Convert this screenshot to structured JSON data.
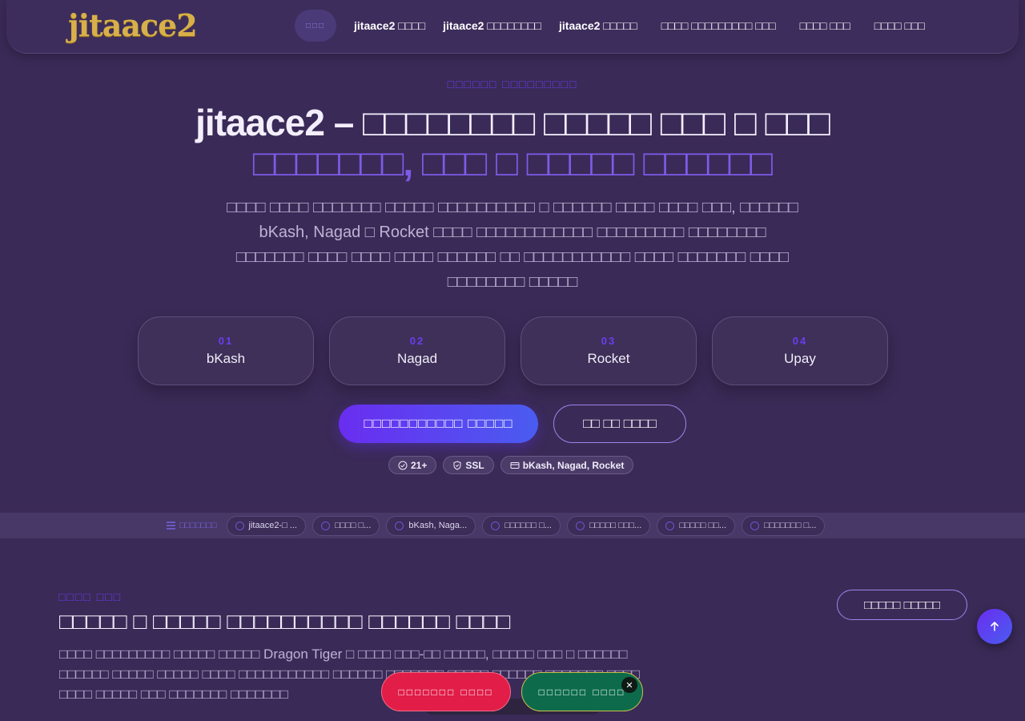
{
  "header": {
    "logo": "jitaace2",
    "home_label": "□□□",
    "nav": [
      "jitaace2 □□□□",
      "jitaace2 □□□□□□□□",
      "jitaace2 □□□□□",
      "□□□□ □□□□□□□□□ □□□",
      "□□□□ □□□",
      "□□□□ □□□"
    ]
  },
  "hero": {
    "eyebrow": "□□□□□□ □□□□□□□□□",
    "title_main": "jitaace2 – □□□□□□□□ □□□□□ □□□ □ □□□",
    "title_accent": "□□□□□□□, □□□ □ □□□□□ □□□□□□",
    "description": "□□□□ □□□□ □□□□□□□ □□□□□ □□□□□□□□□□ □ □□□□□□ □□□□ □□□□ □□□, □□□□□□ bKash, Nagad □ Rocket □□□□ □□□□□□□□□□□□ □□□□□□□□□ □□□□□□□□ □□□□□□□ □□□□ □□□□ □□□□ □□□□□□ □□ □□□□□□□□□□□ □□□□ □□□□□□□ □□□□ □□□□□□□□ □□□□□"
  },
  "payment_methods": [
    {
      "num": "01",
      "name": "bKash"
    },
    {
      "num": "02",
      "name": "Nagad"
    },
    {
      "num": "03",
      "name": "Rocket"
    },
    {
      "num": "04",
      "name": "Upay"
    }
  ],
  "cta": {
    "primary": "□□□□□□□□□□□ □□□□□",
    "secondary": "□□ □□ □□□□"
  },
  "badges": [
    {
      "icon": "check-circle-icon",
      "text": "21+"
    },
    {
      "icon": "shield-icon",
      "text": "SSL"
    },
    {
      "icon": "card-icon",
      "text": "bKash, Nagad, Rocket"
    }
  ],
  "toc": {
    "label": "□□□□□□□",
    "items": [
      "jitaace2-□ ...",
      "□□□□ □...",
      "bKash, Naga...",
      "□□□□□□ □...",
      "□□□□□ □□□...",
      "□□□□□ □□...",
      "□□□□□□□ □..."
    ]
  },
  "section": {
    "eyebrow": "□□□□ □□□",
    "title": "□□□□□ □ □□□□□ □□□□□□□□□□ □□□□□□ □□□□",
    "body": "□□□□ □□□□□□□□□ □□□□□ □□□□□ Dragon Tiger □ □□□□ □□□-□□ □□□□□, □□□□□ □□□ □ □□□□□□ □□□□□□ □□□□□ □□□□□ □□□□ □□□□□□□□□□□ □□□□□□ □□□□□□□ □□□□□ □□□□□□ □□□□□□□ □□□□ □□□□ □□□□□ □□□ □□□□□□□ □□□□□□□",
    "more_button": "□□□□□ □□□□□"
  },
  "sticky": {
    "red_button": "□□□□□□□ □□□□",
    "green_button": "□□□□□□ □□□□",
    "close": "✕"
  },
  "colors": {
    "background": "#3a2a57",
    "accent": "#6b3df0",
    "gold": "#d8b049",
    "red": "#e11d48",
    "green": "#0d6b4c"
  }
}
